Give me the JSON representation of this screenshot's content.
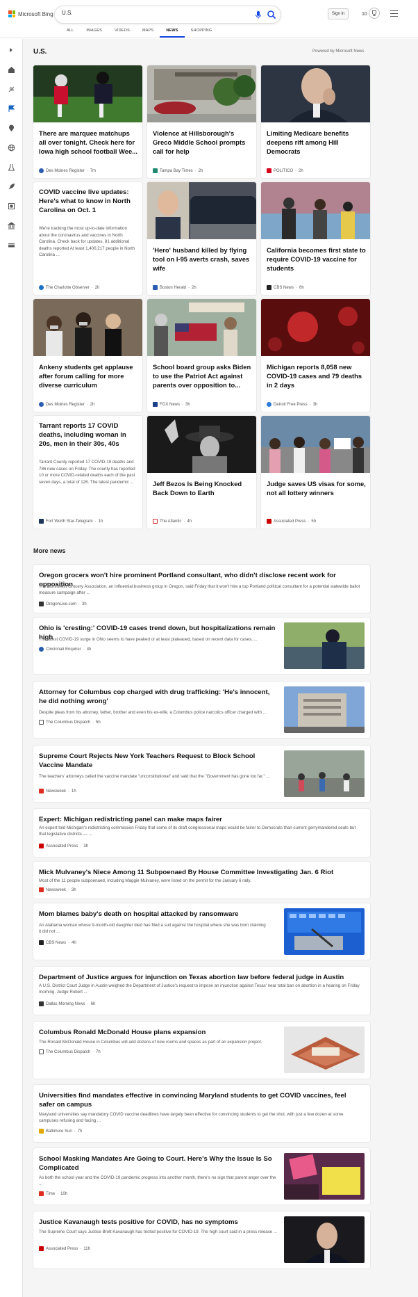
{
  "header": {
    "brand": "Microsoft Bing",
    "query": "U.S.",
    "signin": "Sign in",
    "rewards": "10",
    "tabs": [
      "ALL",
      "IMAGES",
      "VIDEOS",
      "MAPS",
      "NEWS",
      "SHOPPING"
    ],
    "active_tab": "NEWS"
  },
  "sidebar": {
    "icons": [
      "expand-icon",
      "home-icon",
      "sports-icon",
      "flag-icon",
      "location-icon",
      "globe-icon",
      "science-icon",
      "rocket-icon",
      "film-icon",
      "bank-icon",
      "money-icon"
    ]
  },
  "section": {
    "title": "U.S.",
    "powered": "Powered by Microsoft News"
  },
  "cards": [
    {
      "title": "There are marquee matchups all over tonight. Check here for Iowa high school football Wee...",
      "source": "Des Moines Register",
      "age": "7m",
      "src_color": "#2a5db0"
    },
    {
      "title": "Violence at Hillsborough's Greco Middle School prompts call for help",
      "source": "Tampa Bay Times",
      "age": "2h",
      "src_color": "#1f8a70"
    },
    {
      "title": "Limiting Medicare benefits deepens rift among Hill Democrats",
      "source": "POLITICO",
      "age": "2h",
      "src_color": "#d6001c"
    },
    {
      "title": "COVID vaccine live updates: Here's what to know in North Carolina on Oct. 1",
      "snippet": "We're tracking the most up-to-date information about the coronavirus and vaccines in North Carolina. Check back for updates. 81 additional deaths reported At least 1,400,217 people in North Carolina ...",
      "source": "The Charlotte Observer",
      "age": "2h",
      "src_color": "#1a73c9"
    },
    {
      "title": "'Hero' husband killed by flying tool on I-95 averts crash, saves wife",
      "source": "Boston Herald",
      "age": "2h",
      "src_color": "#2a5db0"
    },
    {
      "title": "California becomes first state to require COVID-19 vaccine for students",
      "source": "CBS News",
      "age": "6h",
      "src_color": "#222222"
    },
    {
      "title": "Ankeny students get applause after forum calling for more diverse curriculum",
      "source": "Des Moines Register",
      "age": "2h",
      "src_color": "#2a5db0"
    },
    {
      "title": "School board group asks Biden to use the Patriot Act against parents over opposition to...",
      "source": "FOX News",
      "age": "3h",
      "src_color": "#1b3f8b"
    },
    {
      "title": "Michigan reports 8,058 new COVID-19 cases and 79 deaths in 2 days",
      "source": "Detroit Free Press",
      "age": "3h",
      "src_color": "#2a7bd8"
    },
    {
      "title": "Tarrant reports 17 COVID deaths, including woman in 20s, men in their 30s, 40s",
      "snippet": "Tarrant County reported 17 COVID-19 deaths and 786 new cases on Friday. The county has reported 10 or more COVID-related deaths each of the past seven days, a total of 126. The latest pandemic ...",
      "source": "Fort Worth Star-Telegram",
      "age": "1h",
      "src_color": "#1d3557"
    },
    {
      "title": "Jeff Bezos Is Being Knocked Back Down to Earth",
      "source": "The Atlantic",
      "age": "4h",
      "src_color": "#d62828"
    },
    {
      "title": "Judge saves US visas for some, not all lottery winners",
      "source": "Associated Press",
      "age": "5h",
      "src_color": "#cc0000"
    }
  ],
  "more_news": {
    "title": "More news",
    "items": [
      {
        "title": "Oregon grocers won't hire prominent Portland consultant, who didn't disclose recent work for opposition",
        "snippet": "The Northwest Grocery Association, an influential business group in Oregon, said Friday that it won't hire a top Portland political consultant for a potential statewide ballot measure campaign after ...",
        "source": "OregonLive.com",
        "age": "3h",
        "src_color": "#333333"
      },
      {
        "title": "Ohio is 'cresting:' COVID-19 cases trend down, but hospitalizations remain high",
        "snippet": "The latest COVID-19 surge in Ohio seems to have peaked or at least plateaued, based on recent data for cases, ...",
        "source": "Cincinnati Enquirer",
        "age": "4h",
        "src_color": "#2a5db0"
      },
      {
        "title": "Attorney for Columbus cop charged with drug trafficking: 'He's innocent, he did nothing wrong'",
        "snippet": "Despite pleas from his attorney, father, brother and even his ex-wife, a Columbus police narcotics officer charged with ...",
        "source": "The Columbus Dispatch",
        "age": "5h",
        "src_color": "#555555"
      },
      {
        "title": "Supreme Court Rejects New York Teachers Request to Block School Vaccine Mandate",
        "snippet": "The teachers' attorneys called the vaccine mandate \"unconstitutional\" and said that the \"Government has gone too far.\" ...",
        "source": "Newsweek",
        "age": "1h",
        "src_color": "#e02b20"
      },
      {
        "title": "Expert: Michigan redistricting panel can make maps fairer",
        "snippet": "An expert told Michigan's redistricting commission Friday that some of its draft congressional maps would be fairer to Democrats than current gerrymandered seats but that legislative districts — ...",
        "source": "Associated Press",
        "age": "3h",
        "src_color": "#cc0000"
      },
      {
        "title": "Mick Mulvaney's Niece Among 11 Subpoenaed By House Committee Investigating Jan. 6 Riot",
        "snippet": "Most of the 11 people subpoenaed, including Maggie Mulvaney, were listed on the permit for the January 6 rally.",
        "source": "Newsweek",
        "age": "3h",
        "src_color": "#e02b20"
      },
      {
        "title": "Mom blames baby's death on hospital attacked by ransomware",
        "snippet": "An Alabama woman whose 9-month-old daughter died has filed a suit against the hospital where she was born claiming it did not ...",
        "source": "CBS News",
        "age": "4h",
        "src_color": "#222222"
      },
      {
        "title": "Department of Justice argues for injunction on Texas abortion law before federal judge in Austin",
        "snippet": "A U.S. District Court Judge in Austin weighed the Department of Justice's request to impose an injunction against Texas' near total ban on abortion in a hearing on Friday morning. Judge Robert ...",
        "source": "Dallas Morning News",
        "age": "6h",
        "src_color": "#333333"
      },
      {
        "title": "Columbus Ronald McDonald House plans expansion",
        "snippet": "The Ronald McDonald House in Columbus will add dozens of new rooms and spaces as part of an expansion project.",
        "source": "The Columbus Dispatch",
        "age": "7h",
        "src_color": "#555555"
      },
      {
        "title": "Universities find mandates effective in convincing Maryland students to get COVID vaccines, feel safer on campus",
        "snippet": "Maryland universities say mandatory COVID vaccine deadlines have largely been effective for convincing students to get the shot, with just a few dozen at some campuses refusing and facing ...",
        "source": "Baltimore Sun",
        "age": "7h",
        "src_color": "#e0a800"
      },
      {
        "title": "School Masking Mandates Are Going to Court. Here's Why the Issue Is So Complicated",
        "snippet": "As both the school year and the COVID-19 pandemic progress into another month, there's no sign that parent anger over the ...",
        "source": "Time",
        "age": "10h",
        "src_color": "#e02b20"
      },
      {
        "title": "Justice Kavanaugh tests positive for COVID, has no symptoms",
        "snippet": "The Supreme Court says Justice Brett Kavanaugh has tested positive for COVID-19. The high court said in a press release ...",
        "source": "Associated Press",
        "age": "11h",
        "src_color": "#cc0000"
      }
    ]
  }
}
